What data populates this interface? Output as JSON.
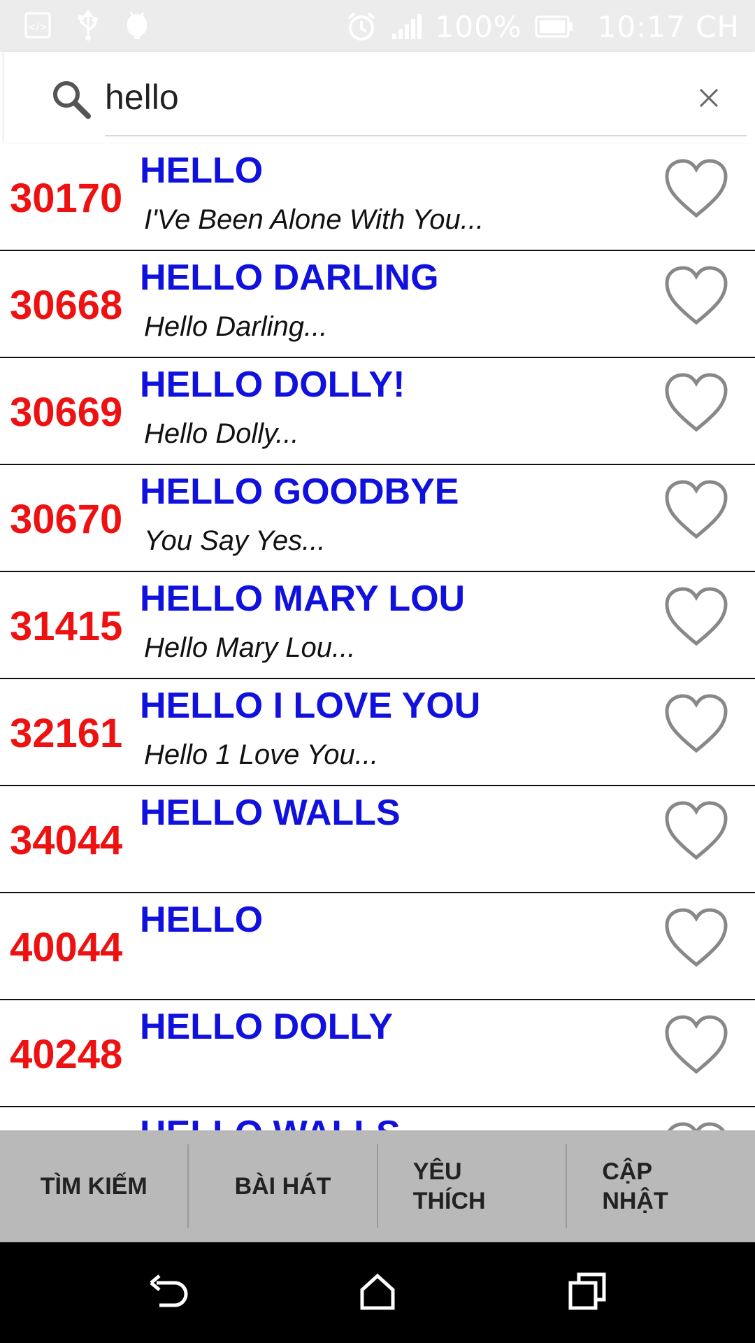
{
  "status_bar": {
    "battery": "100%",
    "time": "10:17 CH"
  },
  "search": {
    "value": "hello",
    "placeholder": ""
  },
  "songs": [
    {
      "number": "30170",
      "title": "HELLO",
      "lyric": "I'Ve Been Alone With You..."
    },
    {
      "number": "30668",
      "title": "HELLO DARLING",
      "lyric": "Hello Darling..."
    },
    {
      "number": "30669",
      "title": "HELLO DOLLY!",
      "lyric": "Hello Dolly..."
    },
    {
      "number": "30670",
      "title": "HELLO GOODBYE",
      "lyric": "You Say Yes..."
    },
    {
      "number": "31415",
      "title": "HELLO MARY LOU",
      "lyric": "Hello Mary Lou..."
    },
    {
      "number": "32161",
      "title": "HELLO I LOVE YOU",
      "lyric": "Hello 1 Love You..."
    },
    {
      "number": "34044",
      "title": "HELLO WALLS",
      "lyric": ""
    },
    {
      "number": "40044",
      "title": "HELLO",
      "lyric": ""
    },
    {
      "number": "40248",
      "title": "HELLO DOLLY",
      "lyric": ""
    },
    {
      "number": "",
      "title": "HELLO WALLS",
      "lyric": ""
    }
  ],
  "tabs": [
    {
      "label": "TÌM KIẾM"
    },
    {
      "label": "BÀI HÁT"
    },
    {
      "label": "YÊU\nTHÍCH"
    },
    {
      "label": "CẬP\nNHẬT"
    }
  ],
  "colors": {
    "number": "#ee1111",
    "title": "#1111dd",
    "tab_bar": "#b9b9b9",
    "status_bar": "#ececec"
  }
}
